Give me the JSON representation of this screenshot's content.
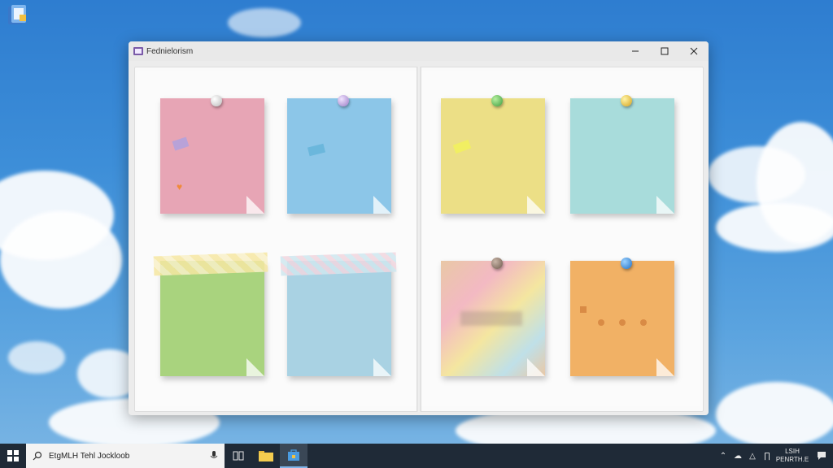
{
  "window": {
    "title": "Fednielorism"
  },
  "taskbar": {
    "search_text": "EtgMLH Tehl Jockloob",
    "clock_time": "LSIH",
    "clock_date": "PENRTH.E"
  },
  "notes": [
    {
      "color": "#e7a5b5"
    },
    {
      "color": "#8cc6e8"
    },
    {
      "color": "#ecdf86"
    },
    {
      "color": "#a8dcdb"
    },
    {
      "color": "#a9d37e"
    },
    {
      "color": "#a9d2e3"
    },
    {
      "color": "#e9c8a6"
    },
    {
      "color": "#f1b165"
    }
  ]
}
